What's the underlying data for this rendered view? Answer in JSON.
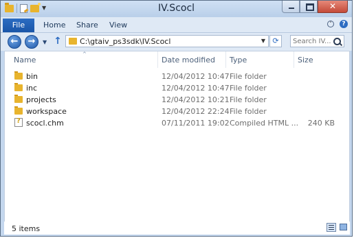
{
  "window": {
    "title": "IV.Scocl"
  },
  "ribbon": {
    "file_tab": "File",
    "tabs": [
      "Home",
      "Share",
      "View"
    ]
  },
  "nav": {
    "address": "C:\\gtaiv_ps3sdk\\IV.Scocl",
    "search_placeholder": "Search IV...."
  },
  "columns": {
    "name": "Name",
    "date_modified": "Date modified",
    "type": "Type",
    "size": "Size"
  },
  "files": [
    {
      "name": "bin",
      "date": "12/04/2012 10:47",
      "type": "File folder",
      "size": "",
      "icon": "folder-icon"
    },
    {
      "name": "inc",
      "date": "12/04/2012 10:47",
      "type": "File folder",
      "size": "",
      "icon": "folder-icon"
    },
    {
      "name": "projects",
      "date": "12/04/2012 10:21",
      "type": "File folder",
      "size": "",
      "icon": "folder-icon"
    },
    {
      "name": "workspace",
      "date": "12/04/2012 22:24",
      "type": "File folder",
      "size": "",
      "icon": "folder-icon"
    },
    {
      "name": "scocl.chm",
      "date": "07/11/2011 19:02",
      "type": "Compiled HTML ...",
      "size": "240 KB",
      "icon": "chm-file-icon"
    }
  ],
  "status": {
    "item_count": "5 items"
  },
  "colors": {
    "accent": "#1a56a8",
    "folder": "#e8b42e",
    "close": "#c44a38"
  }
}
